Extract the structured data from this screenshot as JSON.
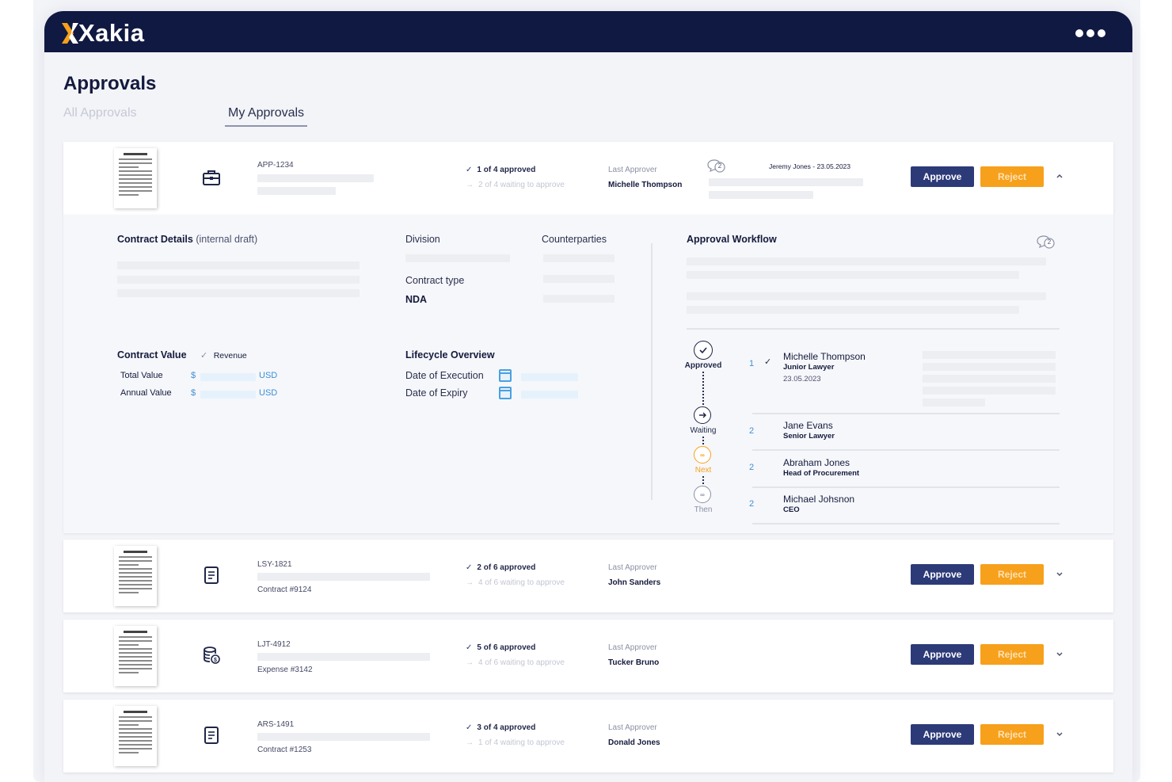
{
  "app": {
    "name": "Xakia"
  },
  "page": {
    "title": "Approvals"
  },
  "tabs": [
    {
      "label": "All Approvals",
      "active": false
    },
    {
      "label": "My Approvals",
      "active": true
    }
  ],
  "buttons": {
    "approve": "Approve",
    "reject": "Reject"
  },
  "labels": {
    "last_approver": "Last Approver"
  },
  "approvals": [
    {
      "ref": "APP-1234",
      "subref": "",
      "type_icon": "briefcase-icon",
      "approved": "1 of 4 approved",
      "waiting": "2 of 4 waiting to approve",
      "last_approver": "Michelle Thompson",
      "comment_count": "2",
      "comment_author": "Jeremy Jones - 23.05.2023",
      "expanded": true
    },
    {
      "ref": "LSY-1821",
      "subref": "Contract #9124",
      "type_icon": "contract-icon",
      "approved": "2 of 6 approved",
      "waiting": "4 of 6 waiting to approve",
      "last_approver": "John Sanders",
      "expanded": false
    },
    {
      "ref": "LJT-4912",
      "subref": "Expense #3142",
      "type_icon": "expense-icon",
      "approved": "5 of 6 approved",
      "waiting": "4 of 6 waiting to approve",
      "last_approver": "Tucker Bruno",
      "expanded": false
    },
    {
      "ref": "ARS-1491",
      "subref": "Contract #1253",
      "type_icon": "contract-icon",
      "approved": "3 of 4 approved",
      "waiting": "1 of 4 waiting to approve",
      "last_approver": "Donald Jones",
      "expanded": false
    }
  ],
  "details": {
    "contract_details_title": "Contract Details",
    "contract_details_note": "(internal draft)",
    "division_label": "Division",
    "counterparties_label": "Counterparties",
    "contract_type_label": "Contract type",
    "contract_type_value": "NDA",
    "contract_value_title": "Contract Value",
    "revenue_label": "Revenue",
    "total_value_label": "Total Value",
    "annual_value_label": "Annual Value",
    "currency_symbol": "$",
    "currency_code": "USD",
    "lifecycle_title": "Lifecycle Overview",
    "date_execution_label": "Date of Execution",
    "date_expiry_label": "Date of Expiry"
  },
  "workflow": {
    "title": "Approval Workflow",
    "comment_count": "2",
    "stages": [
      {
        "label": "Approved",
        "color": "#1f2648"
      },
      {
        "label": "Waiting",
        "color": "#1f2648"
      },
      {
        "label": "Next",
        "color": "#f7a01b"
      },
      {
        "label": "Then",
        "color": "#8c90a6"
      }
    ],
    "approvers": [
      {
        "order": "1",
        "name": "Michelle Thompson",
        "role": "Junior Lawyer",
        "date": "23.05.2023"
      },
      {
        "order": "2",
        "name": "Jane Evans",
        "role": "Senior Lawyer"
      },
      {
        "order": "2",
        "name": "Abraham Jones",
        "role": "Head of Procurement"
      },
      {
        "order": "2",
        "name": "Michael Johsnon",
        "role": "CEO"
      }
    ]
  },
  "colors": {
    "navy": "#101941",
    "approve": "#2c3a78",
    "reject": "#f7a01b",
    "link": "#3d8fd6"
  }
}
